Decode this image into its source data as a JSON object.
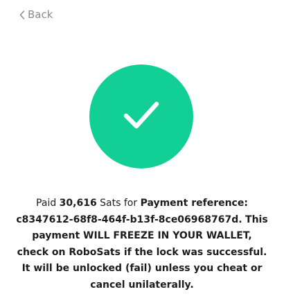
{
  "nav": {
    "back_label": "Back"
  },
  "status": {
    "icon": "checkmark-icon",
    "color": "#12cf96"
  },
  "message": {
    "prefix": "Paid ",
    "amount": "30,616",
    "unit_text": " Sats for ",
    "reference_label": "Payment reference:",
    "reference_id": "c8347612-68f8-464f-b13f-8ce06968767d.",
    "warning": "This payment WILL FREEZE IN YOUR WALLET, check on RoboSats if the lock was successful. It will be unlocked (fail) unless you cheat or cancel unilaterally."
  }
}
